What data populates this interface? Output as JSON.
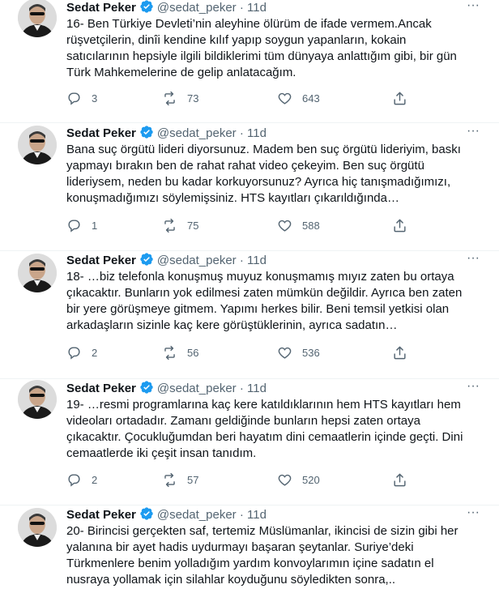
{
  "colors": {
    "verified": "#1d9bf0",
    "secondary_text": "#536471",
    "primary_text": "#0f1419"
  },
  "icons": {
    "verified": "verified-badge-icon",
    "more": "more-dots-icon",
    "reply": "reply-bubble-icon",
    "retweet": "retweet-arrows-icon",
    "like": "heart-icon",
    "share": "share-arrow-icon"
  },
  "tweets": [
    {
      "name": "Sedat Peker",
      "handle": "@sedat_peker",
      "dot": "·",
      "time": "11d",
      "text": "16- Ben Türkiye Devleti’nin aleyhine ölürüm de ifade vermem.Ancak rüşvetçilerin, dinîi kendine kılıf yapıp soygun yapanların, kokain satıcılarının hepsiyle ilgili bildiklerimi tüm dünyaya anlattığım gibi, bir gün Türk Mahkemelerine de gelip anlatacağım.",
      "replies": "3",
      "retweets": "73",
      "likes": "643"
    },
    {
      "name": "Sedat Peker",
      "handle": "@sedat_peker",
      "dot": "·",
      "time": "11d",
      "text": "Bana suç örgütü lideri diyorsunuz. Madem ben suç örgütü lideriyim, baskı yapmayı bırakın ben de rahat rahat video çekeyim. Ben suç örgütü lideriysem, neden bu kadar korkuyorsunuz? Ayrıca hiç tanışmadığımızı, konuşmadığımızı söylemişsiniz. HTS kayıtları çıkarıldığında…",
      "replies": "1",
      "retweets": "75",
      "likes": "588"
    },
    {
      "name": "Sedat Peker",
      "handle": "@sedat_peker",
      "dot": "·",
      "time": "11d",
      "text": "18- …biz telefonla konuşmuş muyuz konuşmamış mıyız zaten bu ortaya çıkacaktır. Bunların yok edilmesi zaten mümkün değildir. Ayrıca ben zaten bir yere görüşmeye gitmem. Yapımı herkes bilir. Beni temsil yetkisi olan arkadaşların sizinle kaç kere görüştüklerinin, ayrıca sadatın…",
      "replies": "2",
      "retweets": "56",
      "likes": "536"
    },
    {
      "name": "Sedat Peker",
      "handle": "@sedat_peker",
      "dot": "·",
      "time": "11d",
      "text": "19- …resmi programlarına kaç kere katıldıklarının hem HTS kayıtları hem videoları ortadadır. Zamanı geldiğinde bunların hepsi zaten ortaya çıkacaktır. Çocukluğumdan beri hayatım dini cemaatlerin içinde geçti. Dini cemaatlerde iki çeşit insan tanıdım.",
      "replies": "2",
      "retweets": "57",
      "likes": "520"
    },
    {
      "name": "Sedat Peker",
      "handle": "@sedat_peker",
      "dot": "·",
      "time": "11d",
      "text": "20- Birincisi gerçekten saf, tertemiz Müslümanlar, ikincisi de sizin gibi her yalanına bir ayet hadis uydurmayı başaran şeytanlar. Suriye’deki Türkmenlere benim yolladığım yardım konvoylarımın içine sadatın el nusraya yollamak için silahlar koyduğunu söyledikten sonra,..",
      "replies": "",
      "retweets": "",
      "likes": ""
    }
  ]
}
